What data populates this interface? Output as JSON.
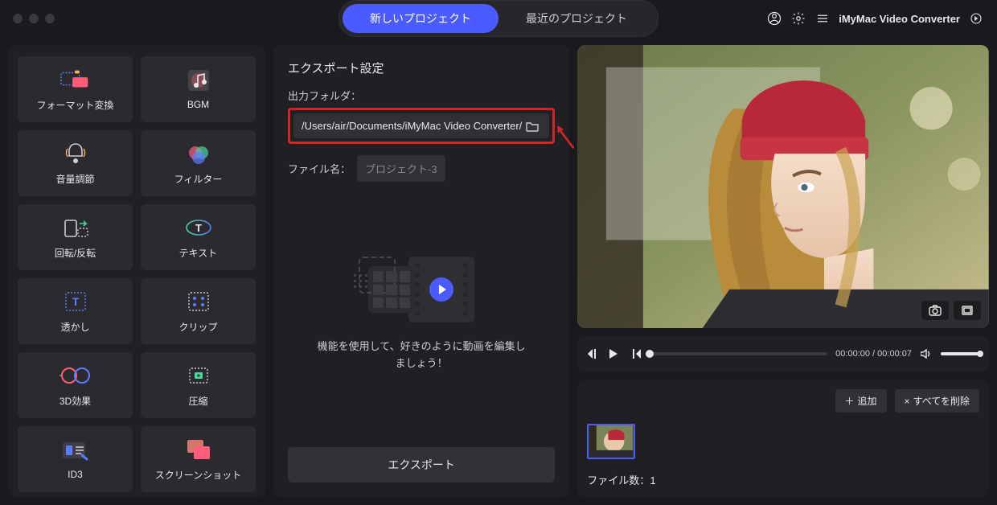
{
  "titlebar": {
    "tab_new": "新しいプロジェクト",
    "tab_recent": "最近のプロジェクト",
    "app_title": "iMyMac Video Converter"
  },
  "sidebar": {
    "tools": [
      {
        "id": "format-convert",
        "label": "フォーマット変換"
      },
      {
        "id": "bgm",
        "label": "BGM"
      },
      {
        "id": "volume",
        "label": "音量調節"
      },
      {
        "id": "filter",
        "label": "フィルター"
      },
      {
        "id": "rotate",
        "label": "回転/反転"
      },
      {
        "id": "text",
        "label": "テキスト"
      },
      {
        "id": "watermark",
        "label": "透かし"
      },
      {
        "id": "clip",
        "label": "クリップ"
      },
      {
        "id": "3d",
        "label": "3D効果"
      },
      {
        "id": "compress",
        "label": "圧縮"
      },
      {
        "id": "id3",
        "label": "ID3"
      },
      {
        "id": "screenshot",
        "label": "スクリーンショット"
      }
    ]
  },
  "center": {
    "heading": "エクスポート設定",
    "output_folder_label": "出力フォルダ：",
    "output_folder": "/Users/air/Documents/iMyMac Video Converter/",
    "filename_label": "ファイル名：",
    "filename_value": "プロジェクト-3",
    "hint": "機能を使用して、好きのように動画を編集しましょう！",
    "export_btn": "エクスポート"
  },
  "preview": {
    "time_current": "00:00:00",
    "time_total": "00:00:07"
  },
  "queue": {
    "add_btn": "追加",
    "delete_all_btn": "すべてを削除",
    "file_count_label": "ファイル数：",
    "file_count": "1"
  }
}
